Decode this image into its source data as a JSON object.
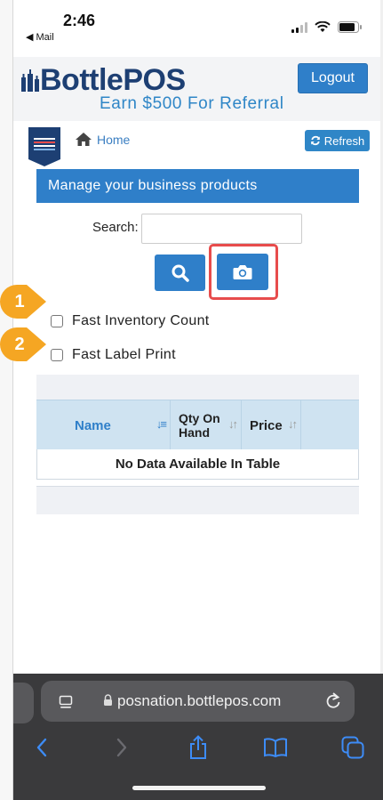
{
  "status_bar": {
    "time": "2:46",
    "back_label": "◀ Mail"
  },
  "header": {
    "brand": "BottlePOS",
    "referral": "Earn $500 For Referral",
    "logout_label": "Logout"
  },
  "nav": {
    "home_label": "Home",
    "refresh_label": "Refresh"
  },
  "panel": {
    "title": "Manage your business products"
  },
  "search": {
    "label": "Search:",
    "value": ""
  },
  "markers": [
    "1",
    "2"
  ],
  "options": {
    "fast_inventory_count": "Fast Inventory Count",
    "fast_label_print": "Fast Label Print"
  },
  "table": {
    "columns": [
      "Name",
      "Qty On Hand",
      "Price"
    ],
    "empty_message": "No Data Available In Table"
  },
  "browser": {
    "url": "posnation.bottlepos.com"
  },
  "colors": {
    "primary": "#2f7fc9",
    "brand_dark": "#1d3f73",
    "marker": "#f5a623",
    "highlight": "#e74c4c"
  }
}
